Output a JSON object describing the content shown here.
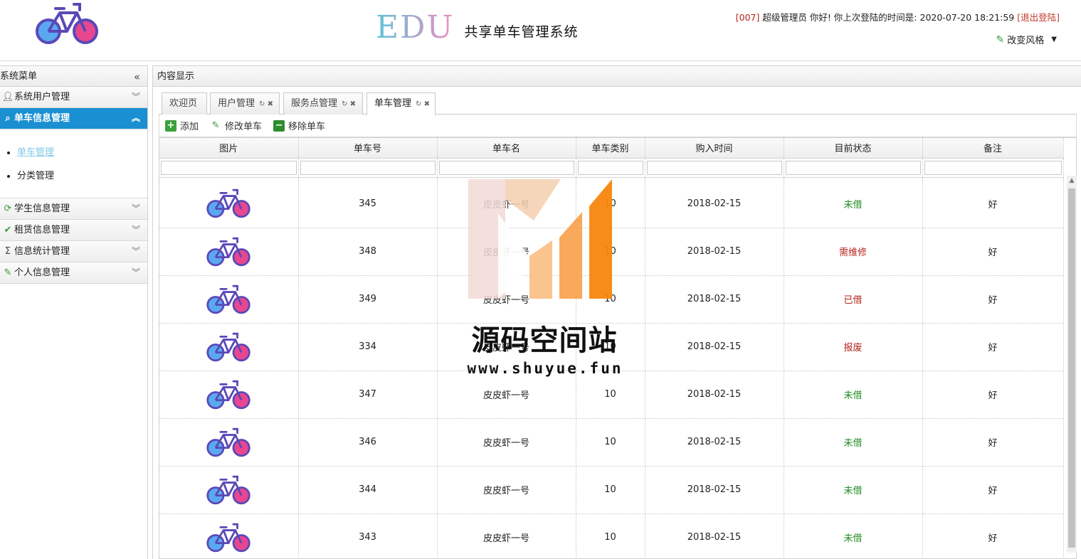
{
  "header": {
    "brand_edu": "EDU",
    "brand_system": "共享单车管理系统",
    "user_id": "[007]",
    "user_role": " 超级管理员",
    "greeting": " 你好! 你上次登陆的时间是: ",
    "last_login": "2020-07-20 18:21:59",
    "logout": " [退出登陆]",
    "style_switch": "改变风格"
  },
  "sidebar": {
    "title": "系统菜单",
    "items": [
      {
        "label": "系统用户管理",
        "icon": "user-icon"
      },
      {
        "label": "单车信息管理",
        "icon": "search-icon",
        "active": true
      },
      {
        "label": "学生信息管理",
        "icon": "refresh-icon"
      },
      {
        "label": "租赁信息管理",
        "icon": "check-icon"
      },
      {
        "label": "信息统计管理",
        "icon": "sigma-icon"
      },
      {
        "label": "个人信息管理",
        "icon": "pencil-icon"
      }
    ],
    "submenu": [
      "单车管理",
      "分类管理"
    ]
  },
  "content": {
    "title": "内容显示",
    "tabs": [
      "欢迎页",
      "用户管理",
      "服务点管理",
      "单车管理"
    ],
    "toolbar": {
      "add": "添加",
      "edit": "修改单车",
      "remove": "移除单车"
    }
  },
  "grid": {
    "columns": [
      "图片",
      "单车号",
      "单车名",
      "单车类别",
      "购入时间",
      "目前状态",
      "备注"
    ],
    "rows": [
      {
        "no": "345",
        "name": "皮皮虾一号",
        "cat": "10",
        "date": "2018-02-15",
        "status": "未借",
        "note": "好"
      },
      {
        "no": "348",
        "name": "皮皮虾一号",
        "cat": "10",
        "date": "2018-02-15",
        "status": "需维修",
        "note": "好"
      },
      {
        "no": "349",
        "name": "皮皮虾一号",
        "cat": "10",
        "date": "2018-02-15",
        "status": "已借",
        "note": "好"
      },
      {
        "no": "334",
        "name": "皮皮虾一号",
        "cat": "10",
        "date": "2018-02-15",
        "status": "报废",
        "note": "好"
      },
      {
        "no": "347",
        "name": "皮皮虾一号",
        "cat": "10",
        "date": "2018-02-15",
        "status": "未借",
        "note": "好"
      },
      {
        "no": "346",
        "name": "皮皮虾一号",
        "cat": "10",
        "date": "2018-02-15",
        "status": "未借",
        "note": "好"
      },
      {
        "no": "344",
        "name": "皮皮虾一号",
        "cat": "10",
        "date": "2018-02-15",
        "status": "未借",
        "note": "好"
      },
      {
        "no": "343",
        "name": "皮皮虾一号",
        "cat": "10",
        "date": "2018-02-15",
        "status": "未借",
        "note": "好"
      }
    ]
  },
  "watermark": {
    "text": "源码空间站",
    "url": "www.shuyue.fun"
  },
  "colors": {
    "accent": "#1a8fd1",
    "status_green": "#1f8a1f",
    "status_red": "#b5231c",
    "bike_blue": "#5aa9f0",
    "bike_pink": "#e8478f",
    "bike_frame": "#5a48b8"
  }
}
